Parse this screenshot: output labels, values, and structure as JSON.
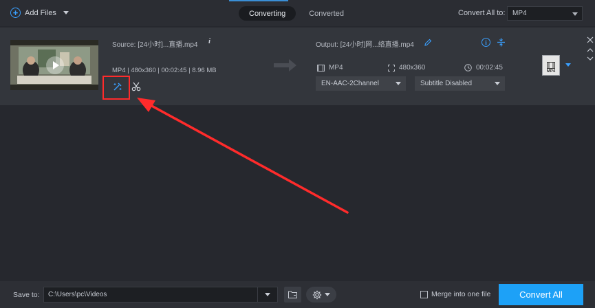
{
  "toolbar": {
    "add_files_label": "Add Files",
    "tabs": [
      {
        "label": "Converting",
        "active": true
      },
      {
        "label": "Converted",
        "active": false
      }
    ],
    "convert_all_to_label": "Convert All to:",
    "convert_all_to_value": "MP4"
  },
  "file": {
    "source_label": "Source: [24小时]...直播.mp4",
    "meta": "MP4 | 480x360 | 00:02:45 | 8.96 MB",
    "output_label": "Output: [24小时]网...络直播.mp4",
    "out_format": "MP4",
    "out_resolution": "480x360",
    "out_duration": "00:02:45",
    "audio_track": "EN-AAC-2Channel",
    "subtitle": "Subtitle Disabled",
    "format_badge": "MP4"
  },
  "bottom": {
    "save_to_label": "Save to:",
    "save_path": "C:\\Users\\pc\\Videos",
    "merge_label": "Merge into one file",
    "convert_all_button": "Convert All"
  },
  "colors": {
    "accent": "#1da1f7",
    "annotation": "#ff2b2b",
    "background": "#26282e"
  }
}
